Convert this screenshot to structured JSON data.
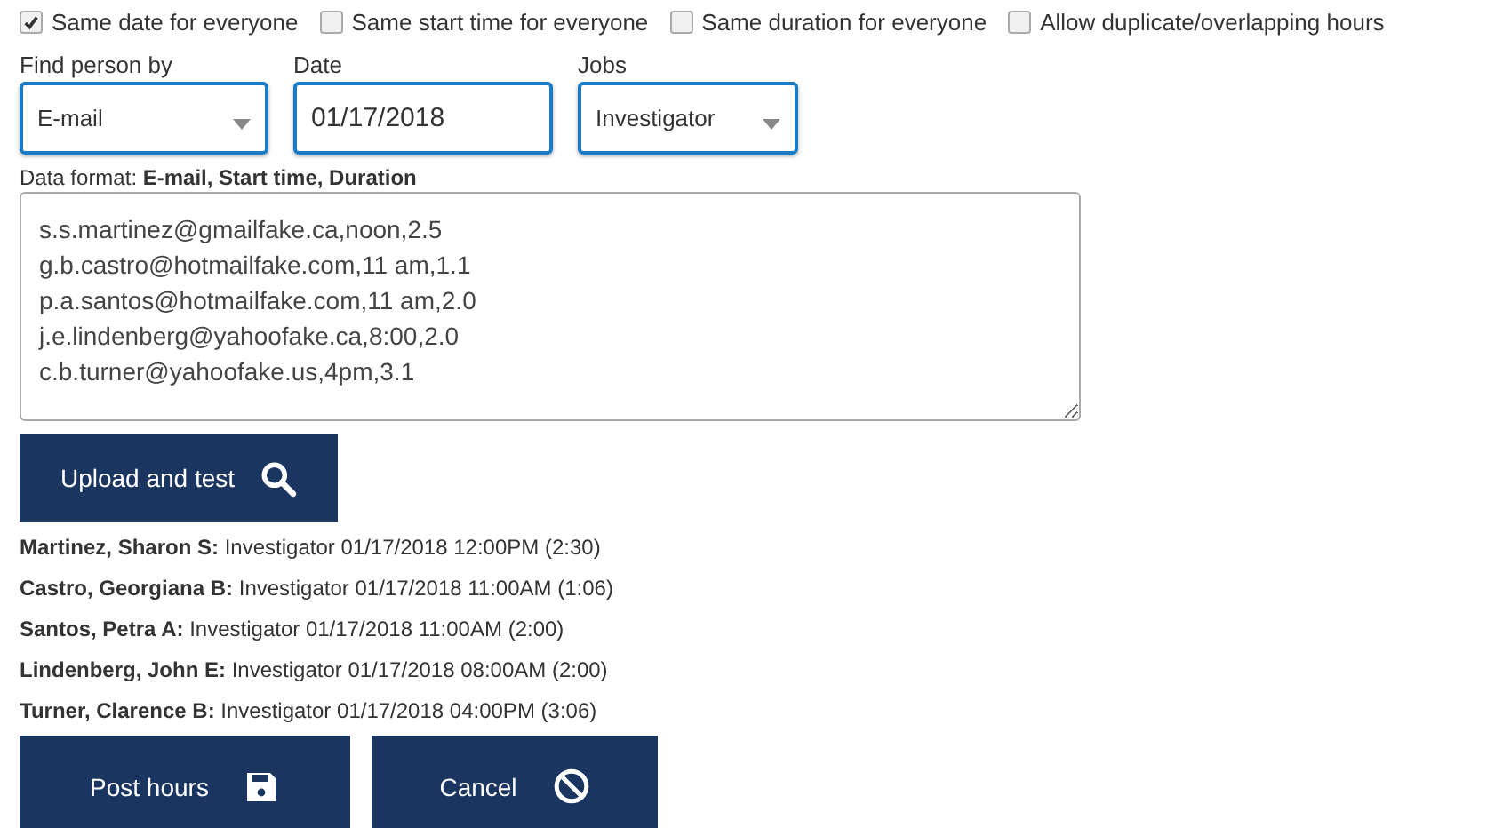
{
  "options": [
    {
      "label": "Same date for everyone",
      "checked": true
    },
    {
      "label": "Same start time for everyone",
      "checked": false
    },
    {
      "label": "Same duration for everyone",
      "checked": false
    },
    {
      "label": "Allow duplicate/overlapping hours",
      "checked": false
    }
  ],
  "fields": [
    {
      "kind": "select",
      "label": "Find person by",
      "value": "E-mail"
    },
    {
      "kind": "text",
      "label": "Date",
      "value": "01/17/2018"
    },
    {
      "kind": "select",
      "label": "Jobs",
      "value": "Investigator"
    }
  ],
  "data_format": "Data format: **E-mail, Start time, Duration**",
  "data_input": {
    "value": "s.s.martinez@gmailfake.ca,noon,2.5\ng.b.castro@hotmailfake.com,11 am,1.1\np.a.santos@hotmailfake.com,11 am,2.0\nj.e.lindenberg@yahoofake.ca,8:00,2.0\nc.b.turner@yahoofake.us,4pm,3.1"
  },
  "upload_button": "Upload and test",
  "results": [
    "**Martinez, Sharon S:** Investigator 01/17/2018 12:00PM (2:30)",
    "**Castro, Georgiana B:** Investigator 01/17/2018 11:00AM (1:06)",
    "**Santos, Petra A:** Investigator 01/17/2018 11:00AM (2:00)",
    "**Lindenberg, John E:** Investigator 01/17/2018 08:00AM (2:00)",
    "**Turner, Clarence B:** Investigator 01/17/2018 04:00PM (3:06)"
  ],
  "actions": [
    {
      "kind": "save",
      "label": "Post hours"
    },
    {
      "kind": "cancel",
      "label": "Cancel"
    }
  ]
}
